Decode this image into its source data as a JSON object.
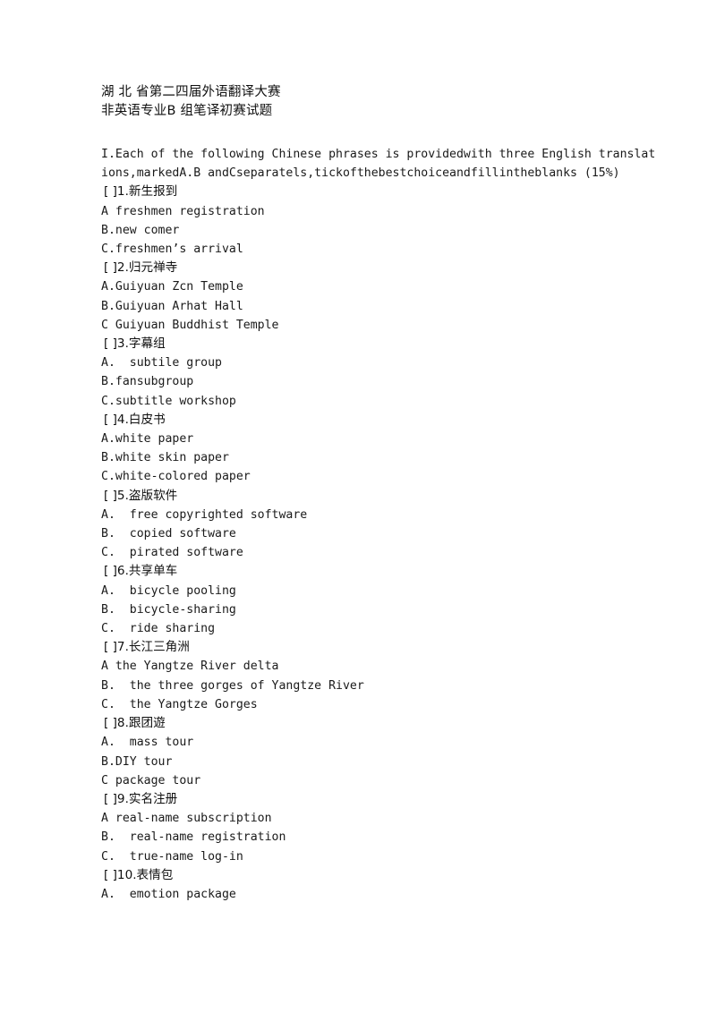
{
  "document": {
    "title_lines": [
      "湖 北 省第二四届外语翻译大赛",
      "非英语专业B 组笔译初赛试题"
    ],
    "instruction": "I.Each of the following Chinese phrases is providedwith three English translations,markedA.B andCseparatels,tickofthebestchoiceandfillintheblanks (15%)",
    "questions": [
      {
        "stem": "[ ]1.新生报到",
        "options": [
          "A freshmen registration",
          "B.new comer",
          "C.freshmen’s arrival"
        ]
      },
      {
        "stem": "[ ]2.归元禅寺",
        "options": [
          "A.Guiyuan Zcn Temple",
          "B.Guiyuan Arhat Hall",
          "C Guiyuan Buddhist Temple"
        ]
      },
      {
        "stem": "[ ]3.字幕组",
        "options": [
          "A.  subtile group",
          "B.fansubgroup",
          "C.subtitle workshop"
        ]
      },
      {
        "stem": "[ ]4.白皮书",
        "options": [
          "A.white paper",
          "B.white skin paper",
          "C.white-colored paper"
        ]
      },
      {
        "stem": "[ ]5.盗版软件",
        "options": [
          "A.  free copyrighted software",
          "B.  copied software",
          "C.  pirated software"
        ]
      },
      {
        "stem": "[ ]6.共享单车",
        "options": [
          "A.  bicycle pooling",
          "B.  bicycle-sharing",
          "C.  ride sharing"
        ]
      },
      {
        "stem": "[ ]7.长江三角洲",
        "options": [
          "A the Yangtze River delta",
          "B.  the three gorges of Yangtze River",
          "C.  the Yangtze Gorges"
        ]
      },
      {
        "stem": "[ ]8.跟团遊",
        "options": [
          "A.  mass tour",
          "B.DIY tour",
          "C package tour"
        ]
      },
      {
        "stem": "[ ]9.实名注册",
        "options": [
          "A real-name subscription",
          "B.  real-name registration",
          "C.  true-name log-in"
        ]
      },
      {
        "stem": "[ ]10.表情包",
        "options": [
          "A.  emotion package"
        ]
      }
    ]
  }
}
